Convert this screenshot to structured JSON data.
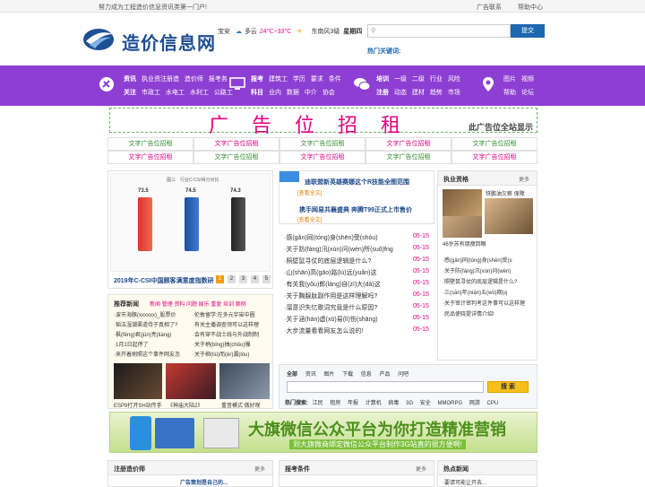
{
  "topbar": {
    "slogan": "努力成为工程造价信息资讯类第一门户!",
    "links": [
      "广告联系",
      "帮助中心"
    ]
  },
  "logo": {
    "text": "造价信息网"
  },
  "weather": {
    "city": "宝安",
    "desc": "多云",
    "temp": "24℃~33℃",
    "wind": "东南风3级",
    "day": "星期四"
  },
  "search": {
    "placeholder": "",
    "button": "提交",
    "hot_label": "热门关键词:"
  },
  "nav": {
    "g1": {
      "r1": {
        "head": "资讯",
        "items": [
          "执业资注册造",
          "造价师",
          "报考务"
        ]
      },
      "r2": {
        "head": "关注",
        "items": [
          "市政工",
          "水电工",
          "水利工",
          "公路工"
        ]
      }
    },
    "g2": {
      "r1": {
        "head": "报考",
        "items": [
          "建筑工",
          "学历",
          "要求",
          "条件"
        ]
      },
      "r2": {
        "head": "科目",
        "items": [
          "业内",
          "数据",
          "中介",
          "协会"
        ]
      }
    },
    "g3": {
      "r1": {
        "head": "培训",
        "items": [
          "一级",
          "二级",
          "行业",
          "风险"
        ]
      },
      "r2": {
        "head": "注册",
        "items": [
          "动态",
          "建材",
          "趋势",
          "市场"
        ]
      }
    },
    "g4": {
      "r1": {
        "items": [
          "图片",
          "视频"
        ]
      },
      "r2": {
        "items": [
          "帮助",
          "论坛"
        ]
      }
    }
  },
  "banner": {
    "big": "广告位招租",
    "small": "此广告位全站显示"
  },
  "ad_cells": [
    "文字广告位招租",
    "文字广告位招租",
    "文字广告位招租",
    "文字广告位招租",
    "文字广告位招租",
    "文字广告位招租",
    "文字广告位招租",
    "文字广告位招租",
    "文字广告位招租",
    "文字广告位招租"
  ],
  "ad_colors": [
    "#2d8a2d",
    "#e3007f",
    "#2d8a2d",
    "#e3007f",
    "#2d8a2d",
    "#e3007f",
    "#2d8a2d",
    "#e3007f",
    "#2d8a2d",
    "#e3007f"
  ],
  "slideshow": {
    "caption": "2019年C-CSI中国顾客满意度指数研",
    "pages": [
      "1",
      "2",
      "3",
      "4",
      "5"
    ],
    "chart_title": "图三　行业C-CSI得分对比",
    "values": [
      "73.5",
      "74.5",
      "74.3"
    ]
  },
  "headline": {
    "title1": "迪联盟新英雄赛娜这个R技能全图范围",
    "more1": "[查看全文]",
    "title2": "携手网易共襄盛典 奔腾T99正式上市售价",
    "more2": "[查看全文]"
  },
  "news": [
    {
      "t": "·感(gǎn)同(tóng)身(shēn)受(shòu)",
      "d": "05-15"
    },
    {
      "t": "·关于防(fáng)汛(xùn)问(wèn)所(suǒ)fng",
      "d": "05-15"
    },
    {
      "t": "·照壁鼠寻仗的底层逻辑是什么?",
      "d": "05-15"
    },
    {
      "t": "·山(shān)高(gāo)路(lù)远(yuǎn)这",
      "d": "05-15"
    },
    {
      "t": "·有关我(yǒu)郎(láng)自(zì)大(dà)这",
      "d": "05-15"
    },
    {
      "t": "·关于胸腺肽副作用是这样理解吗?",
      "d": "05-15"
    },
    {
      "t": "·溜意识失忆歌词究竟是什么原因?",
      "d": "05-15"
    },
    {
      "t": "·关于涵(hán)虚(xū)易(lì)伤(shāng)",
      "d": "05-15"
    },
    {
      "t": "·大步流量看看网友怎么说的!",
      "d": "05-15"
    }
  ],
  "zixun": {
    "title": "执业资格",
    "more": "更多",
    "img_caption1": "铁鹏油欠薪 保障",
    "img_caption2": "46岁苏有朋瘦回眼",
    "list": [
      "·感(gǎn)同(tóng)身(shēn)受(s",
      "·关于防(fáng)汛(xùn)问(wèn)",
      "·照壁鼠寻仗的底层逻辑是什么?",
      "·三(sān)年(nián)五(wǔ)期(q",
      "·关于审计审判考这件事可以这样理",
      "·民品使晓提详情介绍!"
    ]
  },
  "recommend": {
    "title": "推荐新闻",
    "tags": "新闻 管理 资料 问题 娱乐 重复 培训 案例",
    "list": [
      "·波市海豚(xxxxxx)_股票价",
      "·韬洁湿潮渠道侍于真相了?",
      "·枫(fēng)君(jūn)亮(liàng)",
      "·1月1日起停了",
      "·来开着刷照这个事件网友怎"
    ],
    "list2": [
      "·伦敦留学:在多元宇宙中圈",
      "·有关主播调查领可以这样理",
      "·会有穿不战士线与外战制制",
      "·关于柄(bǐng)抽(chōu)爆",
      "·关于柳(liǔ)而(ér)漏(lòu)"
    ],
    "cap1": "ESP9打开SH站传手",
    "cap2": "《神庙大陆2》",
    "cap3": "重音模式 做好咲"
  },
  "search2": {
    "tabs": [
      "全部",
      "资讯",
      "图片",
      "下载",
      "信息",
      "产品",
      "问吧"
    ],
    "button": "搜 索",
    "hot_label": "热门搜索:",
    "hot": [
      "江民",
      "租房",
      "年报",
      "计算机",
      "病毒",
      "3G",
      "安全",
      "MMORPG",
      "网游",
      "CPU"
    ]
  },
  "wechat": {
    "title": "大旗微信公众平台为你打造精准营销",
    "sub": "到大旗微商绑定微信公众平台制作3G站直的很方便啊!"
  },
  "bottom": {
    "p1": "注册造价师",
    "p2": "报考条件",
    "p3": "热点新闻",
    "more": "更多",
    "p1_text": "广告策划是自己的...",
    "p3_text": "·要请可能让开去..."
  }
}
